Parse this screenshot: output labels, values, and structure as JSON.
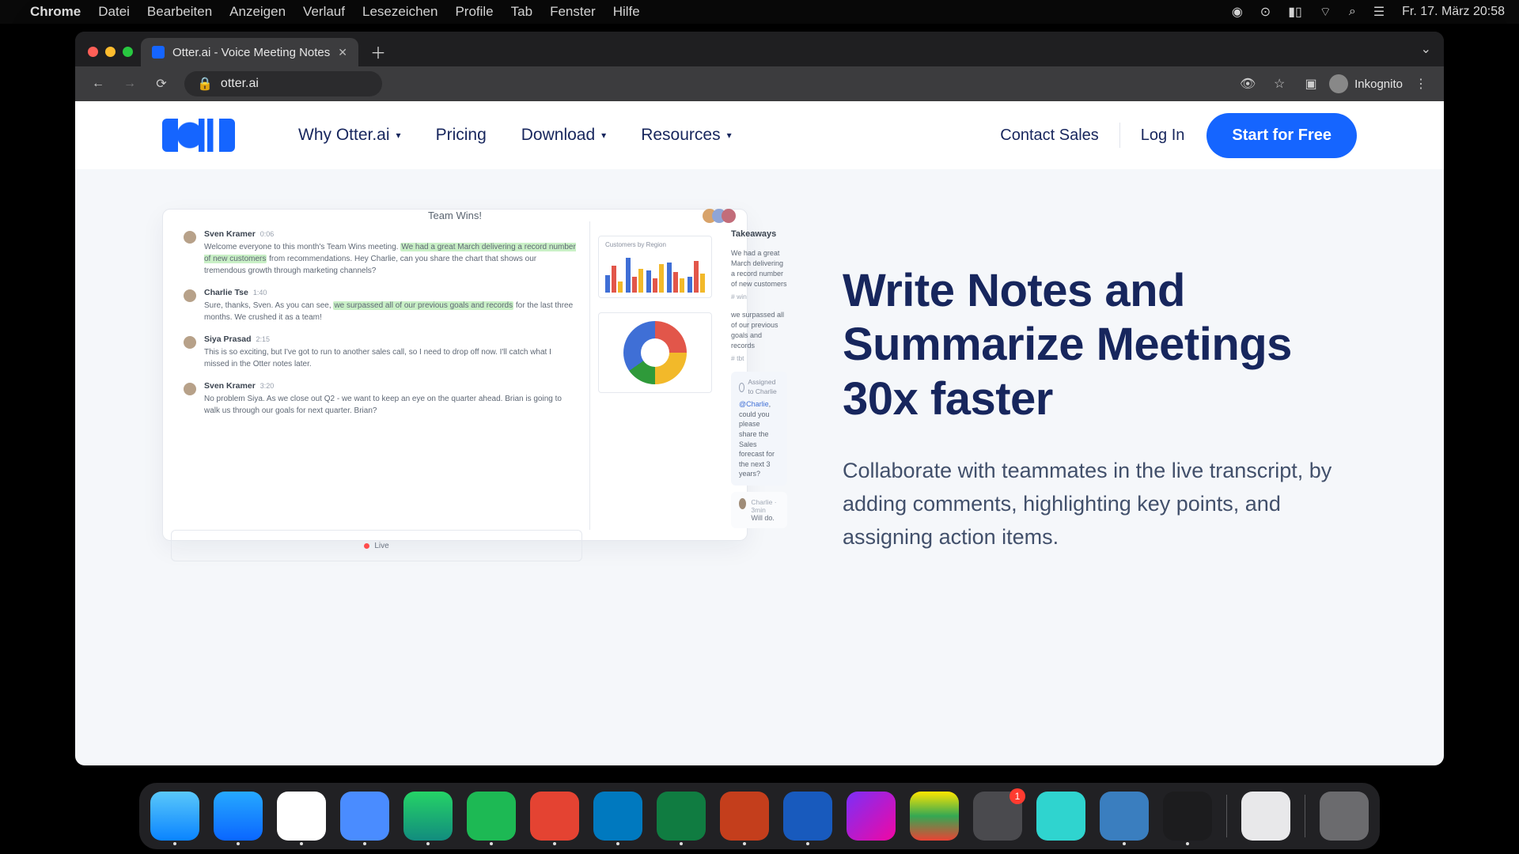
{
  "menubar": {
    "app": "Chrome",
    "items": [
      "Datei",
      "Bearbeiten",
      "Anzeigen",
      "Verlauf",
      "Lesezeichen",
      "Profile",
      "Tab",
      "Fenster",
      "Hilfe"
    ],
    "clock": "Fr. 17. März  20:58"
  },
  "browser": {
    "tab_title": "Otter.ai - Voice Meeting Notes",
    "url": "otter.ai",
    "profile": "Inkognito"
  },
  "nav": {
    "links": [
      "Why Otter.ai",
      "Pricing",
      "Download",
      "Resources"
    ],
    "has_dropdown": [
      true,
      false,
      true,
      true
    ],
    "contact": "Contact Sales",
    "login": "Log In",
    "cta": "Start for Free"
  },
  "hero": {
    "headline": "Write Notes and Summarize Meetings 30x faster",
    "body": "Collaborate with teammates in the live transcript, by adding comments, highlighting key points, and assigning action items."
  },
  "mock": {
    "title": "Team Wins!",
    "live": "Live",
    "messages": [
      {
        "name": "Sven Kramer",
        "ts": "0:06",
        "pre": "Welcome everyone to this month's Team Wins meeting. ",
        "hl": "We had a great March delivering a record number of new customers",
        "post": " from recommendations. Hey Charlie, can you share the chart that shows our tremendous growth through marketing channels?"
      },
      {
        "name": "Charlie Tse",
        "ts": "1:40",
        "pre": "Sure, thanks, Sven. As you can see, ",
        "hl": "we surpassed all of our previous goals and records",
        "post": " for the last three months. We crushed it as a team!"
      },
      {
        "name": "Siya Prasad",
        "ts": "2:15",
        "pre": "This is so exciting, but I've got to run to another sales call, so I need to drop off now. I'll catch what I missed in the Otter notes later.",
        "hl": "",
        "post": ""
      },
      {
        "name": "Sven Kramer",
        "ts": "3:20",
        "pre": "No problem Siya. As we close out Q2 - we want to keep an eye on the quarter ahead. Brian is going to walk us through our goals for next quarter. Brian?",
        "hl": "",
        "post": ""
      }
    ],
    "chart_label": "Customers by Region",
    "takeaways_title": "Takeaways",
    "take1": "We had a great March delivering a record number of new customers",
    "hash1": "# win",
    "take2": "we surpassed all of our previous goals and records",
    "hash2": "# tbt",
    "assign_label": "Assigned to Charlie",
    "assign_body_pre": "",
    "assign_mention": "@Charlie",
    "assign_body_post": ", could you please share the Sales forecast for the next 3 years?",
    "reply_meta": "Charlie · 3min",
    "reply_body": "Will do."
  },
  "dock": {
    "apps": [
      "Finder",
      "Safari",
      "Chrome",
      "Zoom",
      "WhatsApp",
      "Spotify",
      "Todoist",
      "Trello",
      "Excel",
      "PowerPoint",
      "Word",
      "iMovie",
      "Drive",
      "Settings",
      "App1",
      "QuickTime",
      "VoiceMemos",
      "Preview",
      "Trash"
    ],
    "colors": [
      "linear-gradient(#5ac8fa,#0a84ff)",
      "linear-gradient(#26a9ff,#0a66ff)",
      "#fff",
      "#4a8cff",
      "linear-gradient(#25d366,#128c7e)",
      "#1db954",
      "#e44332",
      "#0079bf",
      "#107c41",
      "#c43e1c",
      "#185abd",
      "linear-gradient(135deg,#7b2ff7,#f107a3)",
      "linear-gradient(#ffe600,#34a853 50%,#ea4335)",
      "#4a4a4e",
      "#2fd4cf",
      "#3a7ebf",
      "#1c1c1e",
      "#e8e8ea",
      "#6b6b6e"
    ],
    "badge_index": 13,
    "badge_value": "1",
    "running": [
      0,
      1,
      2,
      3,
      4,
      5,
      6,
      7,
      8,
      9,
      10,
      15,
      16
    ]
  }
}
